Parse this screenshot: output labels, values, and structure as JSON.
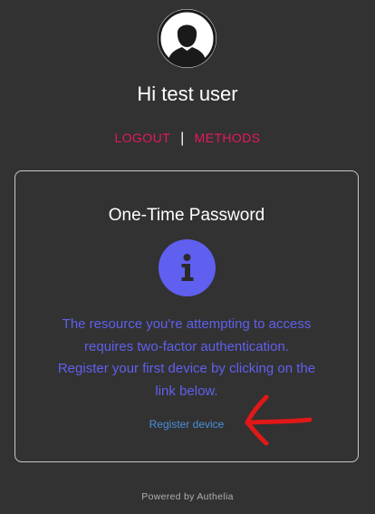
{
  "user": {
    "greeting": "Hi test user"
  },
  "nav": {
    "logout_label": "LOGOUT",
    "separator": "|",
    "methods_label": "METHODS"
  },
  "card": {
    "title": "One-Time Password",
    "message_line1": "The resource you're attempting to access",
    "message_line2": "requires two-factor authentication.",
    "message_line3": "Register your first device by clicking on the",
    "message_line4": "link below.",
    "register_link": "Register device"
  },
  "footer": {
    "text": "Powered by Authelia"
  },
  "icons": {
    "avatar": "user-avatar-icon",
    "info": "info-icon",
    "annotation": "red-arrow-icon"
  },
  "colors": {
    "accent_link": "#e8185c",
    "info_blue": "#5f5ff0",
    "annotation_red": "#e01818"
  }
}
